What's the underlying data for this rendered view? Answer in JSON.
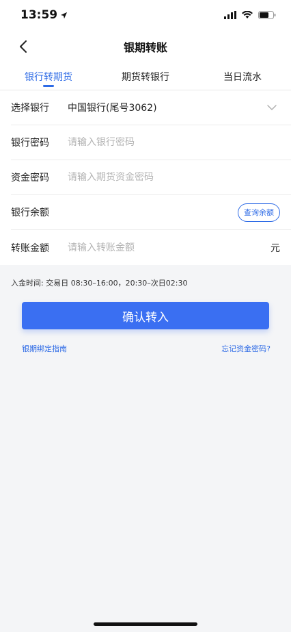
{
  "status": {
    "time": "13:59"
  },
  "nav": {
    "title": "银期转账"
  },
  "tabs": [
    {
      "label": "银行转期货"
    },
    {
      "label": "期货转银行"
    },
    {
      "label": "当日流水"
    }
  ],
  "form": {
    "bank": {
      "label": "选择银行",
      "value": "中国银行(尾号3062)"
    },
    "bank_password": {
      "label": "银行密码",
      "placeholder": "请输入银行密码"
    },
    "fund_password": {
      "label": "资金密码",
      "placeholder": "请输入期货资金密码"
    },
    "bank_balance": {
      "label": "银行余额",
      "button": "查询余额"
    },
    "amount": {
      "label": "转账金额",
      "placeholder": "请输入转账金额",
      "unit": "元"
    }
  },
  "hint": "入金时间: 交易日 08:30–16:00，20:30–次日02:30",
  "confirm_label": "确认转入",
  "links": {
    "guide": "银期绑定指南",
    "forgot": "忘记资金密码?"
  },
  "colors": {
    "accent": "#2e6be6",
    "button": "#3a6ff2"
  }
}
